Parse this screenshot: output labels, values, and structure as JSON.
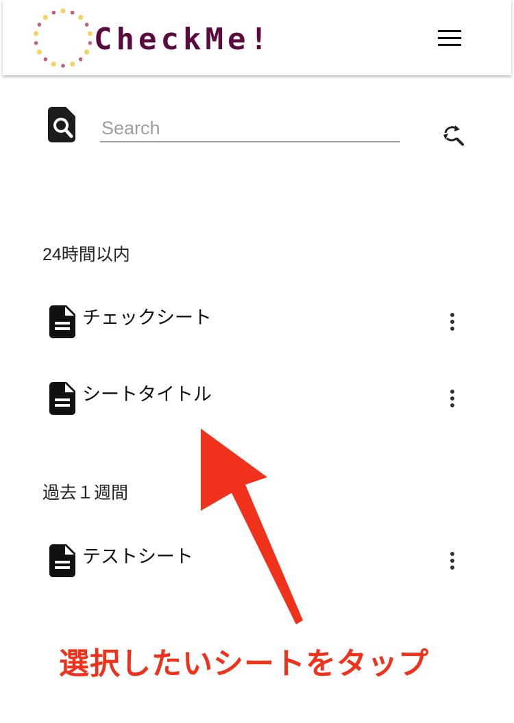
{
  "header": {
    "app_name": "CheckMe!",
    "brand_color": "#5b0a3e",
    "logo_dot_colors": [
      "#f4d35e",
      "#c2607a"
    ],
    "menu_icon": "hamburger-menu-icon"
  },
  "search": {
    "placeholder": "Search",
    "value": "",
    "search_icon": "document-search-icon",
    "refresh_icon": "refresh-search-icon"
  },
  "sections": [
    {
      "title": "24時間以内",
      "items": [
        {
          "label": "チェックシート",
          "icon": "document-icon",
          "menu_icon": "more-vert-icon"
        },
        {
          "label": "シートタイトル",
          "icon": "document-icon",
          "menu_icon": "more-vert-icon"
        }
      ]
    },
    {
      "title": "過去１週間",
      "items": [
        {
          "label": "テストシート",
          "icon": "document-icon",
          "menu_icon": "more-vert-icon"
        }
      ]
    }
  ],
  "annotation": {
    "caption": "選択したいシートをタップ",
    "color": "#f0321c"
  }
}
